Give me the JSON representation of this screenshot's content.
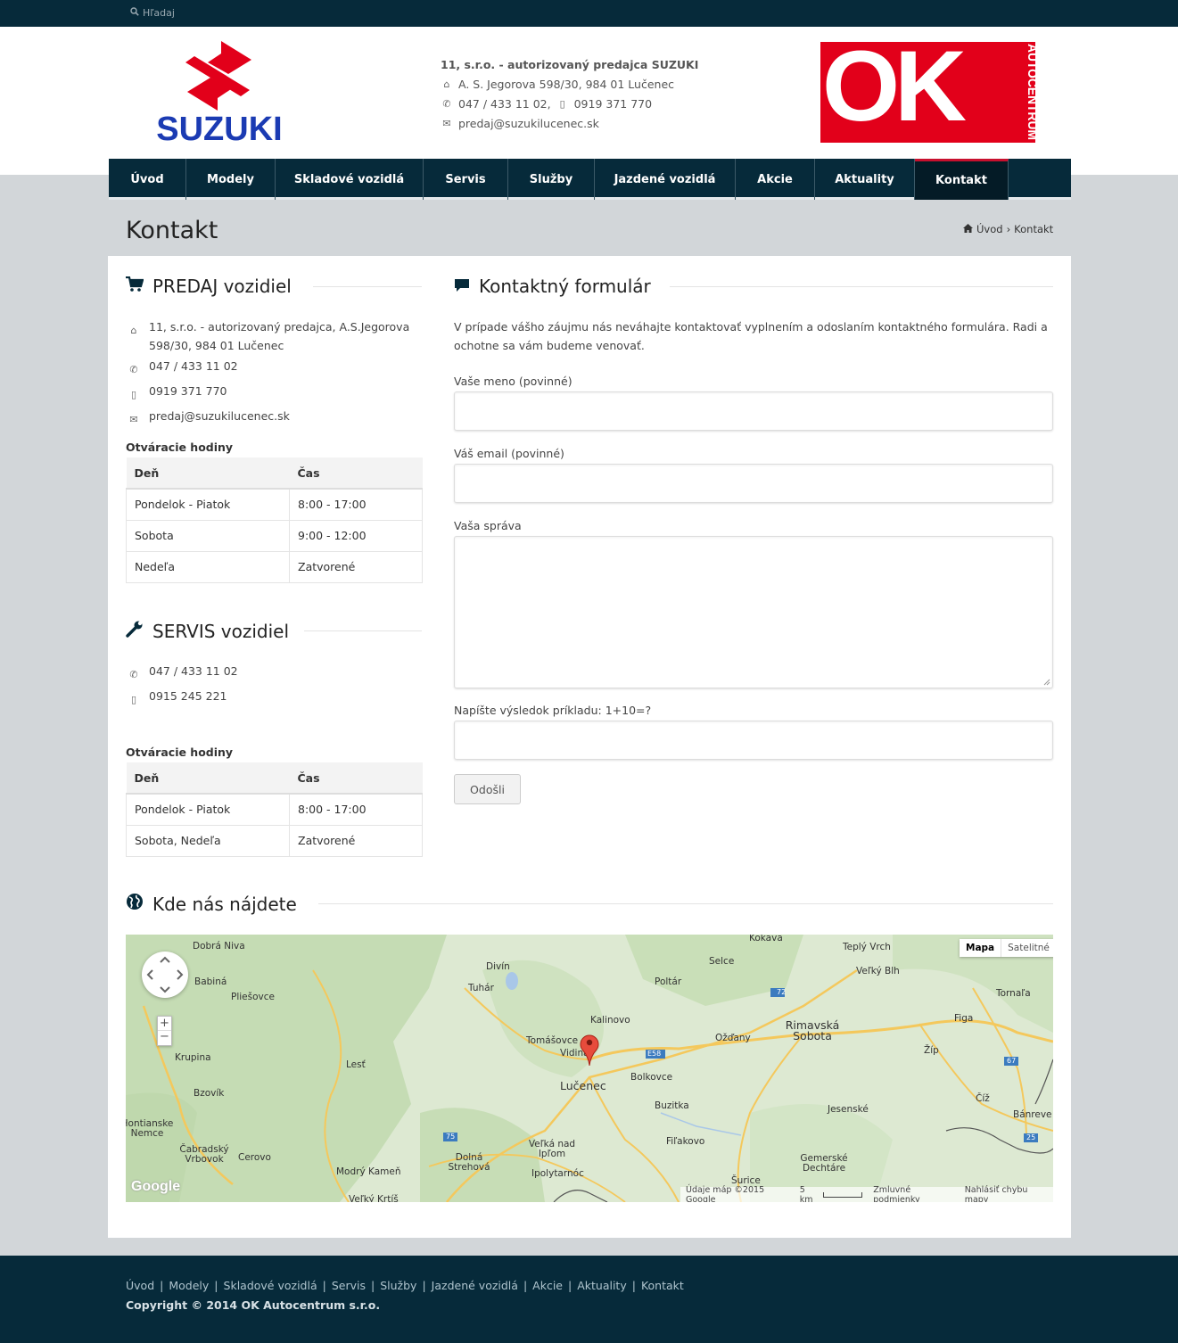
{
  "topbar": {
    "search_label": "Hľadaj"
  },
  "header": {
    "company": "11, s.r.o. - autorizovaný predajca SUZUKI",
    "address": "A. S. Jegorova 598/30, 984 01 Lučenec",
    "phone1": "047 / 433 11 02,",
    "phone2": "0919 371 770",
    "email": "predaj@suzukilucenec.sk",
    "brand": "SUZUKI",
    "partner_logo": "OK",
    "partner_side": "AUTOCENTRUM"
  },
  "nav": {
    "items": [
      "Úvod",
      "Modely",
      "Skladové vozidlá",
      "Servis",
      "Služby",
      "Jazdené vozidlá",
      "Akcie",
      "Aktuality",
      "Kontakt"
    ],
    "active": "Kontakt"
  },
  "page": {
    "title": "Kontakt",
    "breadcrumb_home": "Úvod",
    "breadcrumb_sep": "›",
    "breadcrumb_current": "Kontakt"
  },
  "sales": {
    "heading": "PREDAJ vozidiel",
    "address_l1": "11, s.r.o. - autorizovaný predajca, A.S.Jegorova",
    "address_l2": "598/30, 984 01 Lučenec",
    "phone": "047 / 433 11 02",
    "mobile": "0919 371 770",
    "email": "predaj@suzukilucenec.sk",
    "hours_title": "Otváracie hodiny",
    "col_day": "Deň",
    "col_time": "Čas",
    "rows": [
      {
        "day": "Pondelok - Piatok",
        "time": "8:00 - 17:00"
      },
      {
        "day": "Sobota",
        "time": "9:00 - 12:00"
      },
      {
        "day": "Nedeľa",
        "time": "Zatvorené"
      }
    ]
  },
  "service": {
    "heading": "SERVIS vozidiel",
    "phone": "047 / 433 11 02",
    "mobile": "0915 245 221",
    "hours_title": "Otváracie hodiny",
    "col_day": "Deň",
    "col_time": "Čas",
    "rows": [
      {
        "day": "Pondelok - Piatok",
        "time": "8:00 - 17:00"
      },
      {
        "day": "Sobota, Nedeľa",
        "time": "Zatvorené"
      }
    ]
  },
  "form": {
    "heading": "Kontaktný formulár",
    "intro": "V prípade vášho záujmu nás neváhajte kontaktovať vyplnením a odoslaním kontaktného formulára. Radi a ochotne sa vám budeme venovať.",
    "name_label": "Vaše meno (povinné)",
    "email_label": "Váš email (povinné)",
    "message_label": "Vaša správa",
    "captcha_label": "Napíšte výsledok príkladu: 1+10=?",
    "submit": "Odošli"
  },
  "map": {
    "heading": "Kde nás nájdete",
    "type_map": "Mapa",
    "type_sat": "Satelitné",
    "zoom_in": "+",
    "zoom_out": "−",
    "google": "Google",
    "attribution": "Údaje máp ©2015 Google",
    "scale": "5 km",
    "terms": "Zmluvné podmienky",
    "report": "Nahlásiť chybu mapy",
    "places": [
      "Dobrá Niva",
      "Babiná",
      "Pliešovce",
      "Krupina",
      "Bzovík",
      "Čabradský Vrbovok",
      "Cerovo",
      "Lesť",
      "Divín",
      "Tuhár",
      "Poltár",
      "Kalinovo",
      "Tomášovce",
      "Vidiná",
      "Lučenec",
      "Bolkovce",
      "Buzitka",
      "Veľká nad Ipľom",
      "Dolná Strehová",
      "Modrý Kameň",
      "Ipolytarnóc",
      "Fiľakovo",
      "Šurice",
      "Selce",
      "Kokava",
      "Teplý Vrch",
      "Veľký Blh",
      "Rimavská Sobota",
      "Ožďany",
      "Figa",
      "Tornaľa",
      "Žíp",
      "Číž",
      "Jesenské",
      "Gemerské Dechtáre",
      "Bánreve",
      "Veľký Krtíš",
      "Hontianske Nemce"
    ],
    "roads": [
      "72",
      "E58",
      "75",
      "67",
      "25"
    ]
  },
  "footer": {
    "links": [
      "Úvod",
      "Modely",
      "Skladové vozidlá",
      "Servis",
      "Služby",
      "Jazdené vozidlá",
      "Akcie",
      "Aktuality",
      "Kontakt"
    ],
    "copyright": "Copyright © 2014 OK Autocentrum s.r.o."
  },
  "colors": {
    "navy": "#062a3a",
    "red": "#e2001a",
    "suzuki_blue": "#1b3bb3"
  }
}
